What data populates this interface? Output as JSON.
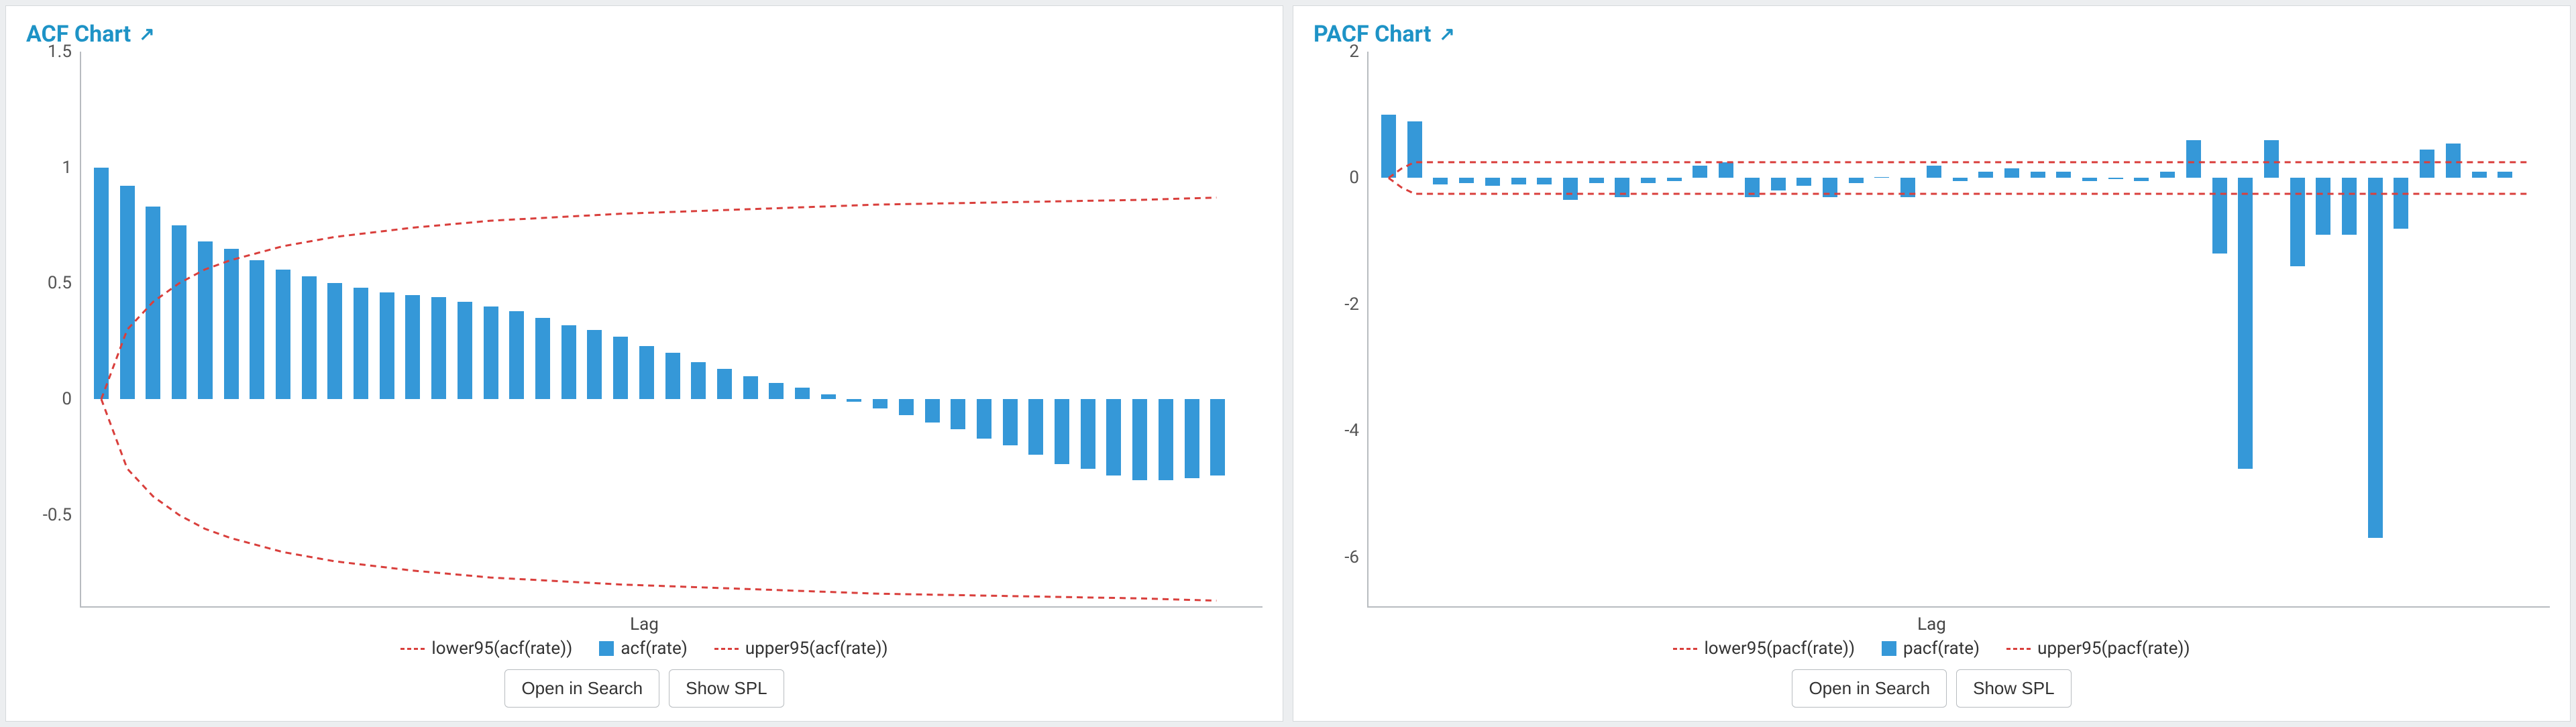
{
  "panels": {
    "left": {
      "title": "ACF Chart",
      "xlabel": "Lag",
      "legend": [
        "lower95(acf(rate))",
        "acf(rate)",
        "upper95(acf(rate))"
      ],
      "buttons": [
        "Open in Search",
        "Show SPL"
      ]
    },
    "right": {
      "title": "PACF Chart",
      "xlabel": "Lag",
      "legend": [
        "lower95(pacf(rate))",
        "pacf(rate)",
        "upper95(pacf(rate))"
      ],
      "buttons": [
        "Open in Search",
        "Show SPL"
      ]
    }
  },
  "chart_data": [
    {
      "type": "bar",
      "title": "ACF Chart",
      "xlabel": "Lag",
      "ylabel": "",
      "ylim": [
        -0.9,
        1.5
      ],
      "yticks": [
        -0.5,
        0,
        0.5,
        1,
        1.5
      ],
      "xlim": [
        0,
        44
      ],
      "series": [
        {
          "name": "acf(rate)",
          "type": "bar",
          "x": [
            0,
            1,
            2,
            3,
            4,
            5,
            6,
            7,
            8,
            9,
            10,
            11,
            12,
            13,
            14,
            15,
            16,
            17,
            18,
            19,
            20,
            21,
            22,
            23,
            24,
            25,
            26,
            27,
            28,
            29,
            30,
            31,
            32,
            33,
            34,
            35,
            36,
            37,
            38,
            39,
            40,
            41,
            42,
            43
          ],
          "values": [
            1.0,
            0.92,
            0.83,
            0.75,
            0.68,
            0.65,
            0.6,
            0.56,
            0.53,
            0.5,
            0.48,
            0.46,
            0.45,
            0.44,
            0.42,
            0.4,
            0.38,
            0.35,
            0.32,
            0.3,
            0.27,
            0.23,
            0.2,
            0.16,
            0.13,
            0.1,
            0.07,
            0.05,
            0.02,
            -0.01,
            -0.04,
            -0.07,
            -0.1,
            -0.13,
            -0.17,
            -0.2,
            -0.24,
            -0.28,
            -0.3,
            -0.33,
            -0.35,
            -0.35,
            -0.34,
            -0.33
          ]
        },
        {
          "name": "upper95(acf(rate))",
          "type": "dashed-line",
          "x": [
            0,
            1,
            2,
            3,
            4,
            5,
            7,
            9,
            12,
            15,
            20,
            25,
            30,
            35,
            40,
            43
          ],
          "values": [
            0.0,
            0.3,
            0.42,
            0.5,
            0.56,
            0.6,
            0.66,
            0.7,
            0.74,
            0.77,
            0.8,
            0.82,
            0.84,
            0.85,
            0.86,
            0.87
          ]
        },
        {
          "name": "lower95(acf(rate))",
          "type": "dashed-line",
          "x": [
            0,
            1,
            2,
            3,
            4,
            5,
            7,
            9,
            12,
            15,
            20,
            25,
            30,
            35,
            40,
            43
          ],
          "values": [
            0.0,
            -0.3,
            -0.42,
            -0.5,
            -0.56,
            -0.6,
            -0.66,
            -0.7,
            -0.74,
            -0.77,
            -0.8,
            -0.82,
            -0.84,
            -0.85,
            -0.86,
            -0.87
          ]
        }
      ]
    },
    {
      "type": "bar",
      "title": "PACF Chart",
      "xlabel": "Lag",
      "ylabel": "",
      "ylim": [
        -6.8,
        2.0
      ],
      "yticks": [
        -6,
        -4,
        -2,
        0,
        2
      ],
      "xlim": [
        0,
        44
      ],
      "series": [
        {
          "name": "pacf(rate)",
          "type": "bar",
          "x": [
            0,
            1,
            2,
            3,
            4,
            5,
            6,
            7,
            8,
            9,
            10,
            11,
            12,
            13,
            14,
            15,
            16,
            17,
            18,
            19,
            20,
            21,
            22,
            23,
            24,
            25,
            26,
            27,
            28,
            29,
            30,
            31,
            32,
            33,
            34,
            35,
            36,
            37,
            38,
            39,
            40,
            41,
            42,
            43
          ],
          "values": [
            1.0,
            0.9,
            -0.1,
            -0.08,
            -0.12,
            -0.1,
            -0.1,
            -0.35,
            -0.08,
            -0.3,
            -0.08,
            -0.05,
            0.2,
            0.25,
            -0.3,
            -0.2,
            -0.12,
            -0.3,
            -0.08,
            0.02,
            -0.3,
            0.2,
            -0.05,
            0.1,
            0.15,
            0.1,
            0.1,
            -0.05,
            -0.02,
            -0.05,
            0.1,
            0.6,
            -1.2,
            -4.6,
            0.6,
            -1.4,
            -0.9,
            -0.9,
            -5.7,
            -0.8,
            0.45,
            0.55,
            0.1,
            0.1
          ]
        },
        {
          "name": "upper95(pacf(rate))",
          "type": "dashed-line",
          "x": [
            0,
            0.5,
            1,
            44
          ],
          "values": [
            0.0,
            0.15,
            0.25,
            0.25
          ]
        },
        {
          "name": "lower95(pacf(rate))",
          "type": "dashed-line",
          "x": [
            0,
            0.5,
            1,
            44
          ],
          "values": [
            0.0,
            -0.15,
            -0.25,
            -0.25
          ]
        }
      ]
    }
  ]
}
